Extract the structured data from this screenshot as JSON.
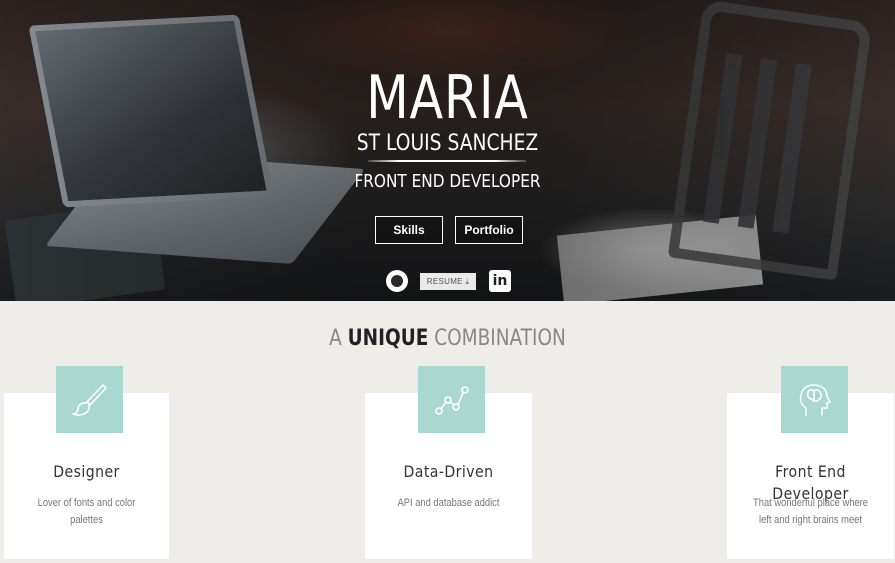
{
  "hero": {
    "first_name": "MARIA",
    "last_name": "ST LOUIS SANCHEZ",
    "role": "FRONT END DEVELOPER",
    "buttons": {
      "skills": "Skills",
      "portfolio": "Portfolio"
    },
    "social": {
      "github_icon": "github-icon",
      "resume_label": "RESUME",
      "resume_icon": "download-icon",
      "linkedin_icon": "in"
    }
  },
  "section": {
    "title_prefix": "A ",
    "title_strong": "UNIQUE",
    "title_suffix": " COMBINATION",
    "accent_color": "#a9d8d1"
  },
  "cards": [
    {
      "icon": "paintbrush-icon",
      "title": "Designer",
      "description": "Lover of fonts and color palettes"
    },
    {
      "icon": "line-chart-icon",
      "title": "Data-Driven",
      "description": "API and database addict"
    },
    {
      "icon": "head-brain-icon",
      "title": "Front End Developer",
      "description": "That wonderful place where left and right brains meet"
    }
  ]
}
